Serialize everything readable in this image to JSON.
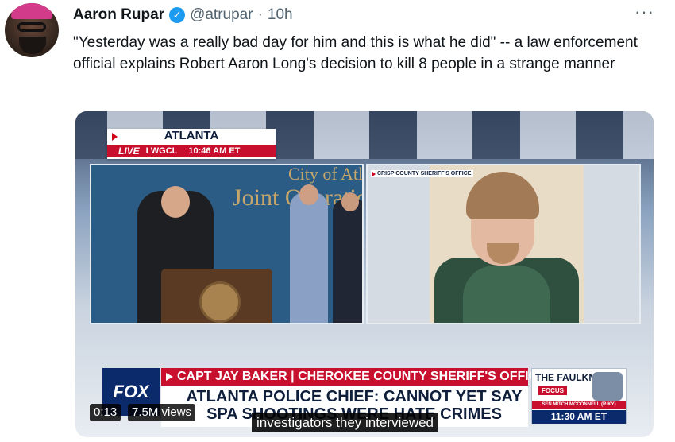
{
  "tweet": {
    "author_name": "Aaron Rupar",
    "handle": "@atrupar",
    "separator": "·",
    "time": "10h",
    "more": "···",
    "verified": "✓",
    "text": "\"Yesterday was a really bad day for him and this is what he did\" -- a law enforcement official explains Robert Aaron Long's decision to kill 8 people in a strange manner"
  },
  "video": {
    "elapsed": "0:13",
    "views": "7.5M views",
    "caption": "investigators they interviewed",
    "ticker": {
      "city": "ATLANTA",
      "live": "LIVE",
      "station": "I  WGCL",
      "time": "10:46 AM ET"
    },
    "wall_text_top": "City of Atl",
    "wall_text": "Joint Operation",
    "mugshot_label": "CRISP COUNTY SHERIFF'S OFFICE",
    "lower_third": {
      "network": "FOX",
      "speaker": "CAPT JAY BAKER | CHEROKEE COUNTY SHERIFF'S OFFICE",
      "headline": "ATLANTA POLICE CHIEF: CANNOT YET SAY SPA SHOOTINGS WERE HATE CRIMES"
    },
    "promo": {
      "title": "THE FAULKNER",
      "subtitle": "FOCUS",
      "name": "SEN MITCH MCCONNELL (R-KY)",
      "time": "11:30 AM ET"
    }
  }
}
